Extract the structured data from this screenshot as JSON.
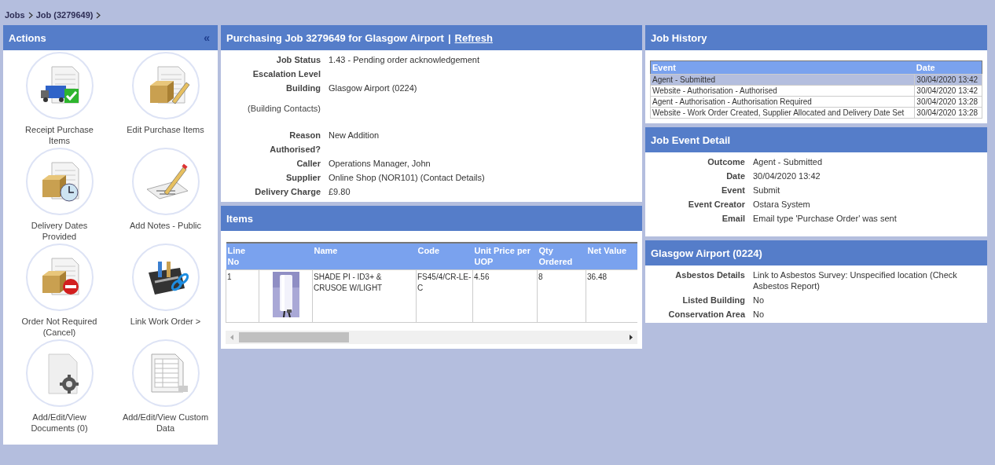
{
  "breadcrumb": [
    {
      "label": "Jobs"
    },
    {
      "label": "Job (3279649)"
    }
  ],
  "actions": {
    "title": "Actions",
    "collapse": "«",
    "items": [
      {
        "label": "Receipt Purchase Items"
      },
      {
        "label": "Edit Purchase Items"
      },
      {
        "label": "Delivery Dates Provided"
      },
      {
        "label": "Add Notes - Public"
      },
      {
        "label": "Order Not Required (Cancel)"
      },
      {
        "label": "Link Work Order >"
      },
      {
        "label": "Add/Edit/View Documents (0)"
      },
      {
        "label": "Add/Edit/View Custom Data"
      }
    ]
  },
  "job": {
    "title": "Purchasing Job 3279649 for Glasgow Airport",
    "separator": "|",
    "refresh": "Refresh",
    "fields": [
      {
        "label": "Job Status",
        "value": "1.43 - Pending order acknowledgement"
      },
      {
        "label": "Escalation Level"
      },
      {
        "label": "Building",
        "value": "Glasgow Airport (0224)"
      },
      {
        "label": "(Building Contacts)",
        "kind": "link"
      },
      {
        "label": "Reason",
        "value": "New Addition"
      },
      {
        "label": "Authorised?"
      },
      {
        "label": "Caller",
        "value": "Operations Manager, John"
      },
      {
        "label": "Supplier",
        "value": "Online Shop (NOR101) (Contact Details)"
      },
      {
        "label": "Delivery Charge",
        "value": "£9.80"
      }
    ]
  },
  "items": {
    "title": "Items",
    "columns": [
      "Line No",
      "",
      "Name",
      "Code",
      "Unit Price per UOP",
      "Qty Ordered",
      "Net Value"
    ],
    "rows": [
      {
        "line_no": "1",
        "name": "SHADE PI - ID3+ & CRUSOE W/LIGHT",
        "code": "FS45/4/CR-LE-C",
        "unit_price": "4.56",
        "qty": "8",
        "net_value": "36.48"
      }
    ]
  },
  "history": {
    "title": "Job History",
    "columns": [
      "Event",
      "Date"
    ],
    "rows": [
      {
        "event": "Agent - Submitted",
        "date": "30/04/2020 13:42",
        "selected": true
      },
      {
        "event": "Website - Authorisation - Authorised",
        "date": "30/04/2020 13:42",
        "selected": false
      },
      {
        "event": "Agent - Authorisation - Authorisation Required",
        "date": "30/04/2020 13:28",
        "selected": false
      },
      {
        "event": "Website - Work Order Created, Supplier Allocated and Delivery Date Set",
        "date": "30/04/2020 13:28",
        "selected": false
      }
    ]
  },
  "event_detail": {
    "title": "Job Event Detail",
    "fields": [
      {
        "label": "Outcome",
        "value": "Agent - Submitted"
      },
      {
        "label": "Date",
        "value": "30/04/2020 13:42"
      },
      {
        "label": "Event",
        "value": "Submit"
      },
      {
        "label": "Event Creator",
        "value": "Ostara System"
      },
      {
        "label": "Email",
        "value": "Email type 'Purchase Order' was sent"
      }
    ]
  },
  "building": {
    "title": "Glasgow Airport (0224)",
    "fields": [
      {
        "label": "Asbestos Details",
        "value": "Link to Asbestos Survey: Unspecified location (Check Asbestos Report)"
      },
      {
        "label": "Listed Building",
        "value": "No"
      },
      {
        "label": "Conservation Area",
        "value": "No"
      }
    ]
  }
}
